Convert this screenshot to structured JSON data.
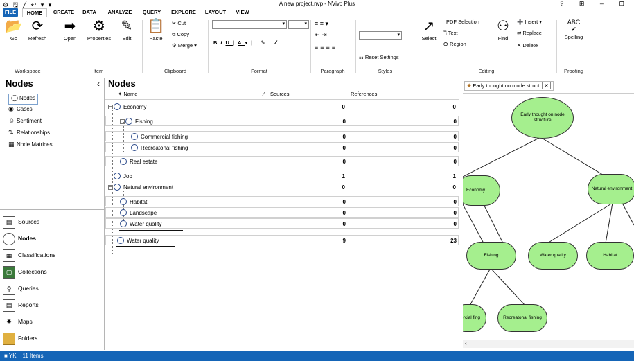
{
  "window": {
    "title": "A new project.nvp - NVivo Plus",
    "controls": [
      "?",
      "⊞",
      "–",
      "⊡"
    ],
    "quick_access": "⚙ 🖫 ╱ ↶ ▾ ▾"
  },
  "tabs": [
    "FILE",
    "HOME",
    "CREATE",
    "DATA",
    "ANALYZE",
    "QUERY",
    "EXPLORE",
    "LAYOUT",
    "VIEW"
  ],
  "ribbon": {
    "groups": [
      "Workspace",
      "Item",
      "Clipboard",
      "Format",
      "Paragraph",
      "Styles",
      "Editing",
      "Proofing"
    ],
    "go": "Go",
    "refresh": "Refresh",
    "open": "Open",
    "properties": "Properties",
    "edit": "Edit",
    "paste": "Paste",
    "cut": "Cut",
    "copy": "Copy",
    "merge": "Merge",
    "reset_settings": "Reset Settings",
    "select": "Select",
    "pdf_selection": "PDF Selection",
    "text": "Text",
    "region": "Region",
    "find": "Find",
    "insert": "Insert",
    "replace": "Replace",
    "delete": "Delete",
    "spelling": "Spelling",
    "spelling_glyph": "ABC",
    "format_b": "B",
    "format_i": "I",
    "format_u": "U",
    "format_a": "A"
  },
  "nav": {
    "title": "Nodes",
    "tree": [
      "Nodes",
      "Cases",
      "Sentiment",
      "Relationships",
      "Node Matrices"
    ],
    "buttons": [
      "Sources",
      "Nodes",
      "Classifications",
      "Collections",
      "Queries",
      "Reports",
      "Maps",
      "Folders"
    ]
  },
  "main": {
    "title": "Nodes",
    "columns": {
      "name": "Name",
      "sources": "Sources",
      "references": "References"
    },
    "rows": [
      {
        "name": "Economy",
        "sources": "0",
        "references": "0"
      },
      {
        "name": "Fishing",
        "sources": "0",
        "references": "0"
      },
      {
        "name": "Commercial fishing",
        "sources": "0",
        "references": "0"
      },
      {
        "name": "Recreatonal fishing",
        "sources": "0",
        "references": "0"
      },
      {
        "name": "Real estate",
        "sources": "0",
        "references": "0"
      },
      {
        "name": "Job",
        "sources": "1",
        "references": "1"
      },
      {
        "name": "Natural environment",
        "sources": "0",
        "references": "0"
      },
      {
        "name": "Habitat",
        "sources": "0",
        "references": "0"
      },
      {
        "name": "Landscape",
        "sources": "0",
        "references": "0"
      },
      {
        "name": "Water quality",
        "sources": "0",
        "references": "0"
      },
      {
        "name": "Water quality",
        "sources": "9",
        "references": "23"
      }
    ]
  },
  "map": {
    "tab_label": "Early thought on mode struct",
    "nodes": {
      "root": "Early thought on node structure",
      "economy": "Economy",
      "natural": "Natural environment",
      "fishing": "Fishing",
      "water_quality": "Water quality",
      "habitat": "Habitat",
      "commercial": "ercial fing",
      "recreational": "Recreatonal fishing"
    }
  },
  "status": {
    "user": "YK",
    "items": "11 Items"
  }
}
